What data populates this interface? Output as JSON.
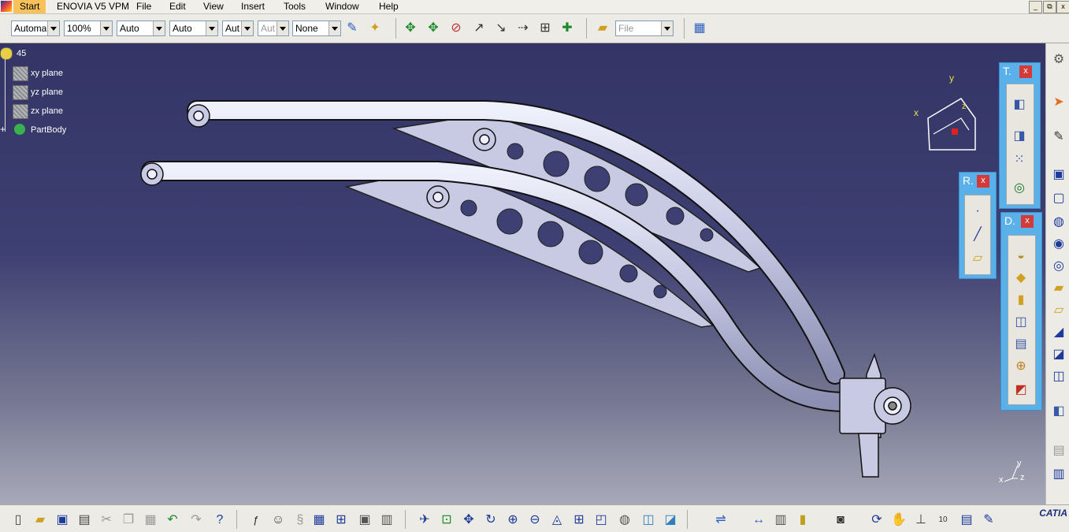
{
  "menu": {
    "start": "Start",
    "items": [
      "ENOVIA V5 VPM",
      "File",
      "Edit",
      "View",
      "Insert",
      "Tools",
      "Window",
      "Help"
    ]
  },
  "window_controls": {
    "minimize": "_",
    "restore": "⧉",
    "close": "x"
  },
  "toolbar": {
    "combos": [
      "Automa",
      "100%",
      "Auto",
      "Auto",
      "Aut",
      "Aut",
      "None"
    ],
    "file_combo": "File"
  },
  "tree": {
    "root": "45",
    "items": [
      "xy plane",
      "yz plane",
      "zx plane",
      "PartBody"
    ]
  },
  "compass": {
    "x": "x",
    "y": "y",
    "z": "z"
  },
  "panels": {
    "t_panel": {
      "title": "T.",
      "close": "x"
    },
    "r_panel": {
      "title": "R.",
      "close": "x"
    },
    "d_panel": {
      "title": "D.",
      "close": "x"
    }
  },
  "axis_triad": {
    "x": "x",
    "y": "y",
    "z": "z"
  },
  "brand": "CATIA",
  "colors": {
    "viewport_top": "#343566",
    "panel": "#5ab0e8",
    "part": "#c4c6e0"
  }
}
